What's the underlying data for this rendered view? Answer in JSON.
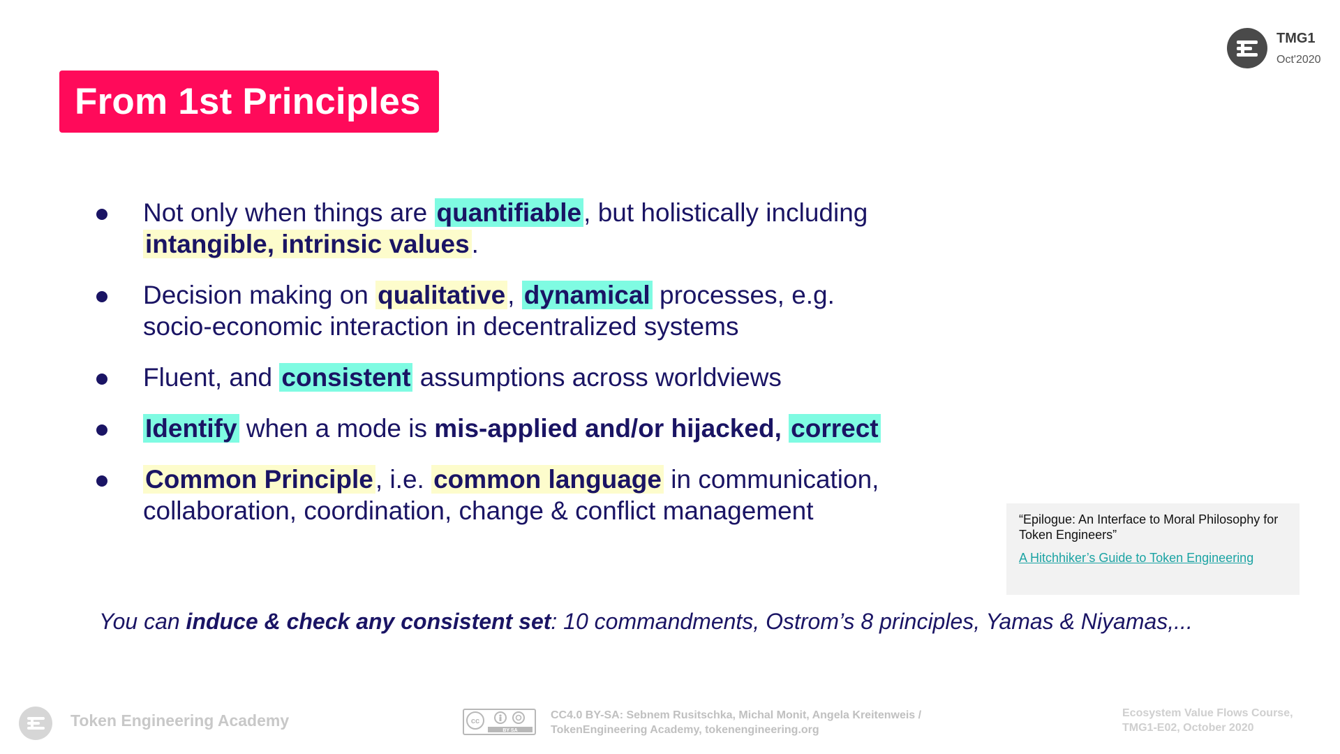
{
  "header": {
    "title": "From 1st Principles",
    "course_code": "TMG1",
    "date": "Oct'2020"
  },
  "bullets": [
    {
      "segments": [
        {
          "text": "Not only when things are ",
          "style": "plain"
        },
        {
          "text": "quantifiable",
          "style": "bold-cyan"
        },
        {
          "text": ", but holistically including ",
          "style": "plain"
        },
        {
          "text": "intangible, intrinsic values",
          "style": "bold-yellow"
        },
        {
          "text": ".",
          "style": "plain"
        }
      ]
    },
    {
      "segments": [
        {
          "text": "Decision making on ",
          "style": "plain"
        },
        {
          "text": "qualitative",
          "style": "bold-yellow"
        },
        {
          "text": ", ",
          "style": "plain"
        },
        {
          "text": "dynamical",
          "style": "bold-cyan"
        },
        {
          "text": " processes, e.g. socio-economic interaction in decentralized systems",
          "style": "plain"
        }
      ]
    },
    {
      "segments": [
        {
          "text": "Fluent, and ",
          "style": "plain"
        },
        {
          "text": "consistent",
          "style": "bold-cyan"
        },
        {
          "text": " assumptions across worldviews",
          "style": "plain"
        }
      ]
    },
    {
      "segments": [
        {
          "text": "Identify",
          "style": "bold-cyan"
        },
        {
          "text": " when a mode is ",
          "style": "plain"
        },
        {
          "text": "mis-applied and/or hijacked, ",
          "style": "bold"
        },
        {
          "text": "correct",
          "style": "bold-cyan"
        }
      ]
    },
    {
      "segments": [
        {
          "text": "Common Principle",
          "style": "bold-yellow"
        },
        {
          "text": ", i.e. ",
          "style": "plain"
        },
        {
          "text": "common language",
          "style": "bold-yellow"
        },
        {
          "text": " in communication, collaboration, coordination, change & conflict management",
          "style": "plain"
        }
      ]
    }
  ],
  "reference": {
    "quote": "“Epilogue: An Interface to Moral Philosophy for Token Engineers”",
    "link_text": "A Hitchhiker’s Guide to Token Engineering"
  },
  "closing": {
    "prefix": "You can ",
    "emphasis": "induce & check any consistent set",
    "suffix": ": 10 commandments, Ostrom’s 8 principles, Yamas & Niyamas,..."
  },
  "footer": {
    "org": "Token Engineering Academy",
    "license_line1": "CC4.0 BY-SA:  Sebnem Rusitschka, Michal Monit, Angela Kreitenweis /",
    "license_line2": "TokenEngineering Academy, tokenengineering.org",
    "course_line1": "Ecosystem Value Flows Course,",
    "course_line2": "TMG1-E02, October 2020",
    "cc_badge_text": "BY  SA"
  },
  "colors": {
    "title_bg": "#ff0a5a",
    "text": "#1a1464",
    "highlight_cyan": "#7ffbe2",
    "highlight_yellow": "#fdfccc",
    "link": "#1ba3a3"
  }
}
